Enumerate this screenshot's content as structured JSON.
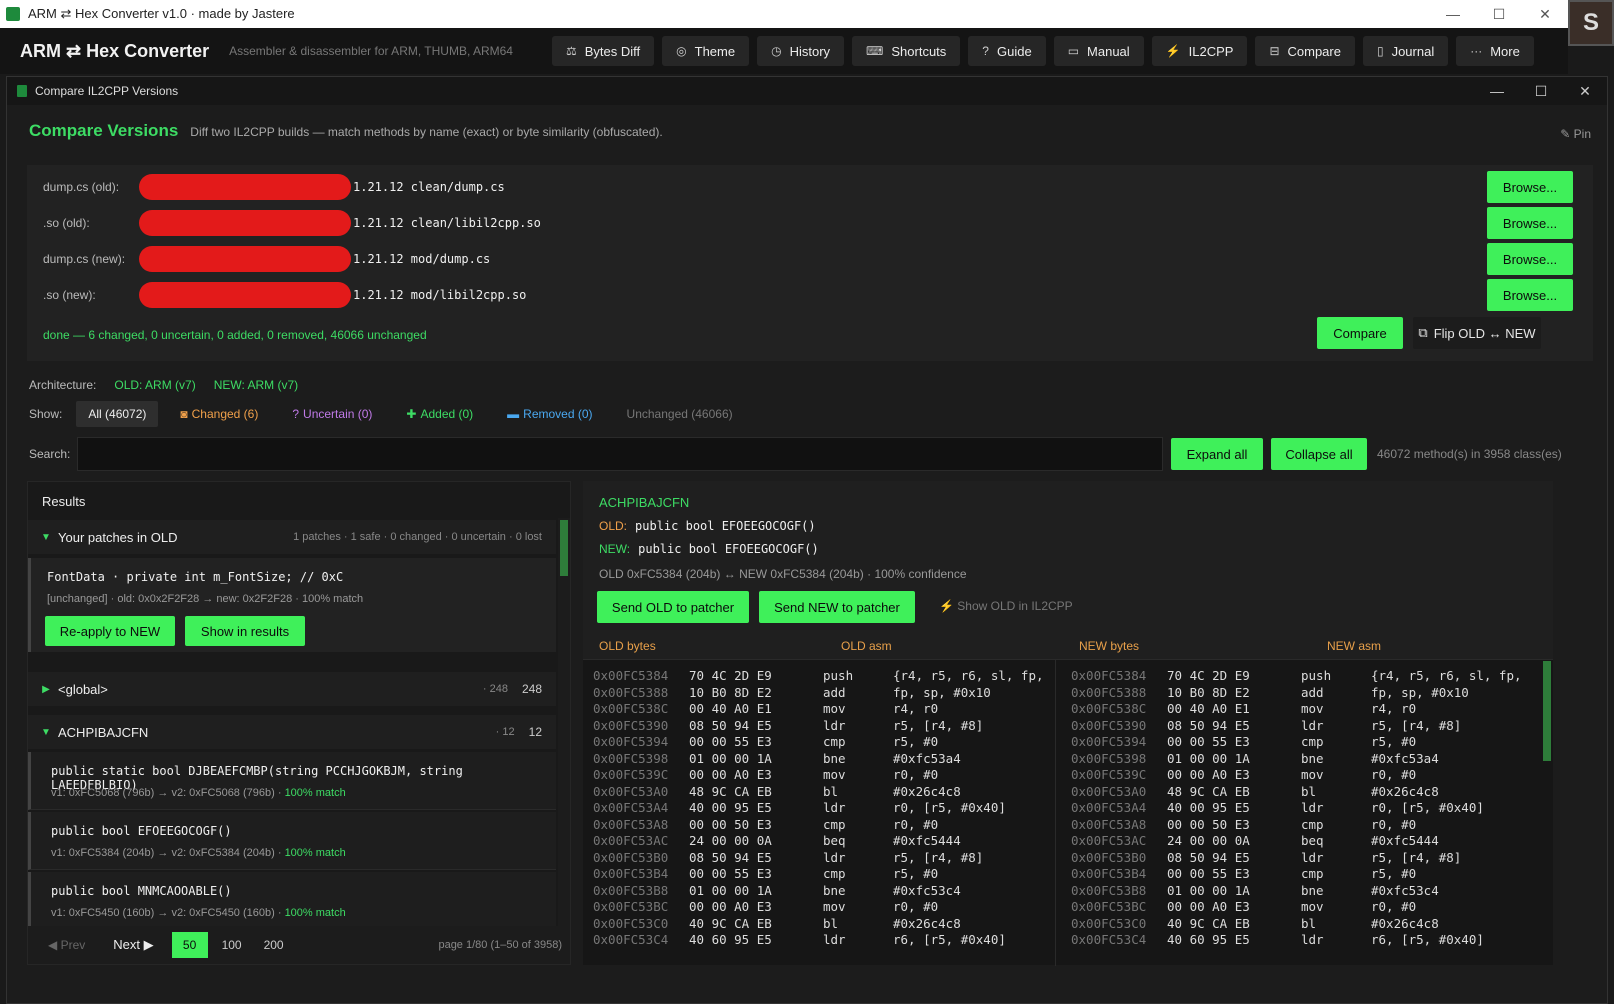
{
  "window": {
    "title": "ARM ⇄ Hex Converter v1.0  ·  made by Jastere",
    "min": "—",
    "max": "☐",
    "close": "✕"
  },
  "avatar": {
    "letter": "S"
  },
  "header": {
    "title": "ARM ⇄ Hex Converter",
    "subtitle": "Assembler & disassembler for ARM, THUMB, ARM64",
    "nav": [
      {
        "label": "Bytes Diff",
        "icon": "bytes-diff-icon",
        "glyph": "⚖"
      },
      {
        "label": "Theme",
        "icon": "palette-icon",
        "glyph": "◎"
      },
      {
        "label": "History",
        "icon": "clock-icon",
        "glyph": "◷"
      },
      {
        "label": "Shortcuts",
        "icon": "keyboard-icon",
        "glyph": "⌨"
      },
      {
        "label": "Guide",
        "icon": "question-icon",
        "glyph": "?"
      },
      {
        "label": "Manual",
        "icon": "book-icon",
        "glyph": "▭"
      },
      {
        "label": "IL2CPP",
        "icon": "plug-icon",
        "glyph": "⚡"
      },
      {
        "label": "Compare",
        "icon": "compare-icon",
        "glyph": "⊟"
      },
      {
        "label": "Journal",
        "icon": "journal-icon",
        "glyph": "▯"
      },
      {
        "label": "More",
        "icon": "more-icon",
        "glyph": "···"
      }
    ]
  },
  "dialog": {
    "title": "Compare IL2CPP Versions",
    "min": "—",
    "max": "☐",
    "close": "✕",
    "heading": "Compare Versions",
    "description": "Diff two IL2CPP builds — match methods by name (exact) or byte similarity (obfuscated).",
    "pin": "Pin",
    "files": [
      {
        "label": "dump.cs (old):",
        "path": "1.21.12 clean/dump.cs",
        "browse": "Browse..."
      },
      {
        "label": ".so (old):",
        "path": "1.21.12 clean/libil2cpp.so",
        "browse": "Browse..."
      },
      {
        "label": "dump.cs (new):",
        "path": "1.21.12 mod/dump.cs",
        "browse": "Browse..."
      },
      {
        "label": ".so (new):",
        "path": "1.21.12 mod/libil2cpp.so",
        "browse": "Browse..."
      }
    ],
    "status": "done — 6 changed, 0 uncertain, 0 added, 0 removed, 46066 unchanged",
    "compare_label": "Compare",
    "flip_label": "Flip OLD ↔ NEW",
    "arch_label": "Architecture:",
    "arch_old": "OLD: ARM (v7)",
    "arch_new": "NEW: ARM (v7)",
    "show_label": "Show:",
    "filters": {
      "all": "All (46072)",
      "changed": "Changed (6)",
      "uncertain": "Uncertain (0)",
      "added": "Added (0)",
      "removed": "Removed (0)",
      "unchanged": "Unchanged (46066)"
    },
    "search_label": "Search:",
    "search_value": "",
    "expand_all": "Expand all",
    "collapse_all": "Collapse all",
    "count_text": "46072 method(s) in 3958 class(es)"
  },
  "results": {
    "title": "Results",
    "patches_group": {
      "name": "Your patches in OLD",
      "meta": "1 patches  ·  1 safe  ·  0 changed  ·  0 uncertain  ·  0 lost"
    },
    "patch": {
      "line1": "FontData  ·  private int m_FontSize; // 0xC",
      "line2": "[unchanged]  · old: 0x0x2F2F28 → new: 0x2F2F28 · 100% match",
      "reapply": "Re-apply to NEW",
      "show": "Show in results"
    },
    "global_group": {
      "name": "<global>",
      "meta": "· 248",
      "count": "248"
    },
    "class_group": {
      "name": "ACHPIBAJCFN",
      "meta": "· 12",
      "count": "12"
    },
    "methods": [
      {
        "sig": "public static bool DJBEAEFCMBP(string PCCHJGOKBJM, string LAEEDFBLBIO)",
        "info": "v1: 0xFC5068 (796b) → v2: 0xFC5068 (796b)  · ",
        "match": "100% match"
      },
      {
        "sig": "public bool EFOEEGOCOGF()",
        "info": "v1: 0xFC5384 (204b) → v2: 0xFC5384 (204b)  · ",
        "match": "100% match"
      },
      {
        "sig": "public bool MNMCAOOABLE()",
        "info": "v1: 0xFC5450 (160b) → v2: 0xFC5450 (160b)  · ",
        "match": "100% match"
      }
    ],
    "pager": {
      "prev": "◀ Prev",
      "next": "Next ▶",
      "sizes": [
        "50",
        "100",
        "200"
      ],
      "info": "page 1/80  (1–50 of 3958)"
    }
  },
  "detail": {
    "class_name": "ACHPIBAJCFN",
    "old_key": "OLD:",
    "old_sig": "public bool EFOEEGOCOGF()",
    "new_key": "NEW:",
    "new_sig": "public bool EFOEEGOCOGF()",
    "meta": "OLD 0xFC5384 (204b) ↔ NEW 0xFC5384 (204b)  ·  100% confidence",
    "send_old": "Send OLD to patcher",
    "send_new": "Send NEW to patcher",
    "show_il": "Show OLD in IL2CPP",
    "hdr_old_bytes": "OLD bytes",
    "hdr_old_asm": "OLD asm",
    "hdr_new_bytes": "NEW bytes",
    "hdr_new_asm": "NEW asm",
    "lines": [
      {
        "addr": "0x00FC5384",
        "bytes": "70 4C 2D E9",
        "mn": "push",
        "op": "{r4, r5, r6, sl, fp,"
      },
      {
        "addr": "0x00FC5388",
        "bytes": "10 B0 8D E2",
        "mn": "add",
        "op": "fp, sp, #0x10"
      },
      {
        "addr": "0x00FC538C",
        "bytes": "00 40 A0 E1",
        "mn": "mov",
        "op": "r4, r0"
      },
      {
        "addr": "0x00FC5390",
        "bytes": "08 50 94 E5",
        "mn": "ldr",
        "op": "r5, [r4, #8]"
      },
      {
        "addr": "0x00FC5394",
        "bytes": "00 00 55 E3",
        "mn": "cmp",
        "op": "r5, #0"
      },
      {
        "addr": "0x00FC5398",
        "bytes": "01 00 00 1A",
        "mn": "bne",
        "op": "#0xfc53a4"
      },
      {
        "addr": "0x00FC539C",
        "bytes": "00 00 A0 E3",
        "mn": "mov",
        "op": "r0, #0"
      },
      {
        "addr": "0x00FC53A0",
        "bytes": "48 9C CA EB",
        "mn": "bl",
        "op": "#0x26c4c8"
      },
      {
        "addr": "0x00FC53A4",
        "bytes": "40 00 95 E5",
        "mn": "ldr",
        "op": "r0, [r5, #0x40]"
      },
      {
        "addr": "0x00FC53A8",
        "bytes": "00 00 50 E3",
        "mn": "cmp",
        "op": "r0, #0"
      },
      {
        "addr": "0x00FC53AC",
        "bytes": "24 00 00 0A",
        "mn": "beq",
        "op": "#0xfc5444"
      },
      {
        "addr": "0x00FC53B0",
        "bytes": "08 50 94 E5",
        "mn": "ldr",
        "op": "r5, [r4, #8]"
      },
      {
        "addr": "0x00FC53B4",
        "bytes": "00 00 55 E3",
        "mn": "cmp",
        "op": "r5, #0"
      },
      {
        "addr": "0x00FC53B8",
        "bytes": "01 00 00 1A",
        "mn": "bne",
        "op": "#0xfc53c4"
      },
      {
        "addr": "0x00FC53BC",
        "bytes": "00 00 A0 E3",
        "mn": "mov",
        "op": "r0, #0"
      },
      {
        "addr": "0x00FC53C0",
        "bytes": "40 9C CA EB",
        "mn": "bl",
        "op": "#0x26c4c8"
      },
      {
        "addr": "0x00FC53C4",
        "bytes": "40 60 95 E5",
        "mn": "ldr",
        "op": "r6, [r5, #0x40]"
      }
    ]
  },
  "colors": {
    "accent": "#3ff05a",
    "accent_text": "#3ddc64",
    "old": "#f0a04a",
    "redaction": "#e31a1a"
  }
}
